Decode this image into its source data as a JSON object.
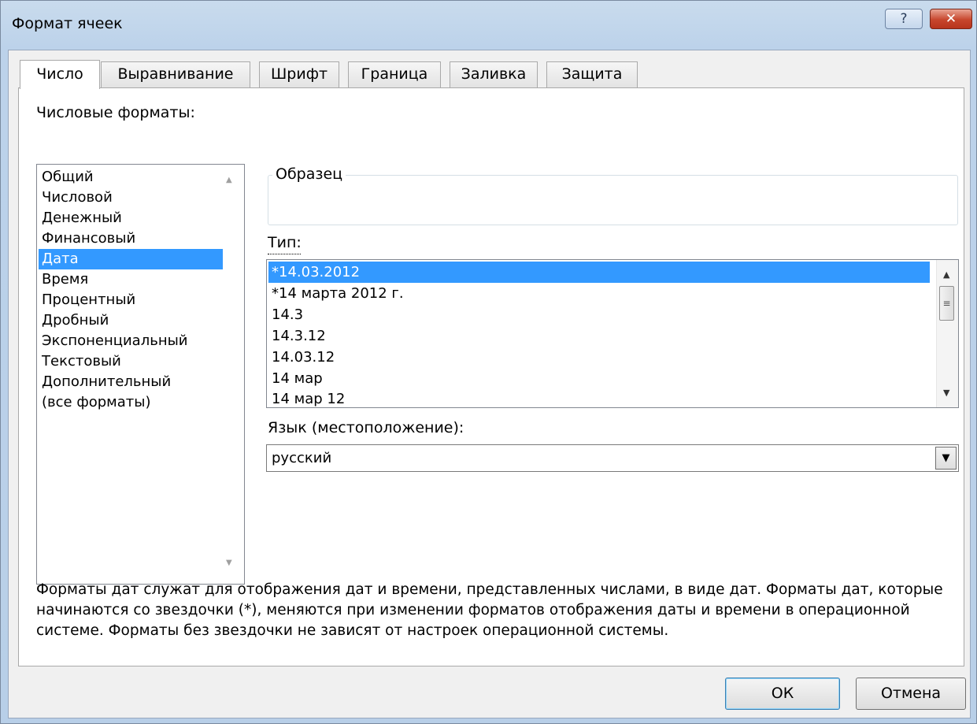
{
  "window": {
    "title": "Формат ячеек",
    "help_label": "?",
    "close_label": "✕"
  },
  "tabs": [
    {
      "label": "Число",
      "active": true
    },
    {
      "label": "Выравнивание",
      "active": false
    },
    {
      "label": "Шрифт",
      "active": false
    },
    {
      "label": "Граница",
      "active": false
    },
    {
      "label": "Заливка",
      "active": false
    },
    {
      "label": "Защита",
      "active": false
    }
  ],
  "categories": {
    "label": "Числовые форматы:",
    "items": [
      "Общий",
      "Числовой",
      "Денежный",
      "Финансовый",
      "Дата",
      "Время",
      "Процентный",
      "Дробный",
      "Экспоненциальный",
      "Текстовый",
      "Дополнительный",
      "(все форматы)"
    ],
    "selected": "Дата"
  },
  "sample": {
    "label": "Образец",
    "value": ""
  },
  "type": {
    "label": "Тип:",
    "items": [
      "*14.03.2012",
      "*14 марта 2012 г.",
      "14.3",
      "14.3.12",
      "14.03.12",
      "14 мар",
      "14 мар 12"
    ],
    "selected": "*14.03.2012"
  },
  "language": {
    "label": "Язык (местоположение):",
    "value": "русский"
  },
  "description": "Форматы дат служат для отображения дат и времени, представленных числами, в виде дат. Форматы дат, которые начинаются со звездочки (*), меняются при изменении форматов отображения даты и времени в операционной системе. Форматы без звездочки не зависят от настроек операционной системы.",
  "buttons": {
    "ok": "ОК",
    "cancel": "Отмена"
  },
  "colors": {
    "selection": "#3399ff",
    "title_bar": "#bcd2ea",
    "close_button": "#c7462d"
  }
}
